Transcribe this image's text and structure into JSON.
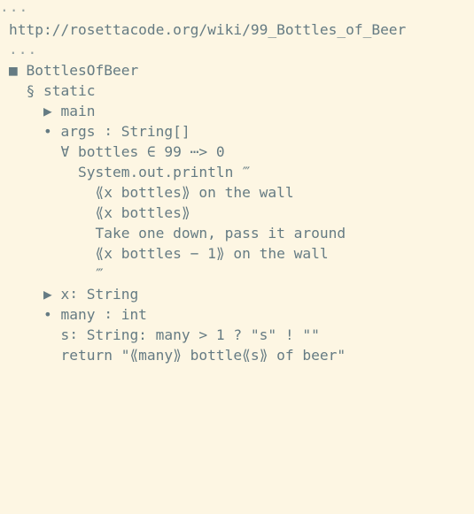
{
  "editor": {
    "top_ellipsis": "...",
    "url": "http://rosettacode.org/wiki/99_Bottles_of_Beer",
    "url_ellipsis": "...",
    "lines": [
      "■ BottlesOfBeer",
      "  § static",
      "    ▶ main",
      "    • args ∶ String[]",
      "      ∀ bottles ∈ 99 ⋯> 0",
      "        System.out.println ‴",
      "          ⟪x bottles⟫ on the wall",
      "          ⟪x bottles⟫",
      "          Take one down, pass it around",
      "          ⟪x bottles − 1⟫ on the wall",
      "          ‴",
      "    ▶ x∶ String",
      "    • many ∶ int",
      "      s∶ String: many > 1 ? \"s\" ! \"\"",
      "      return \"⟪many⟫ bottle⟪s⟫ of beer\""
    ]
  }
}
